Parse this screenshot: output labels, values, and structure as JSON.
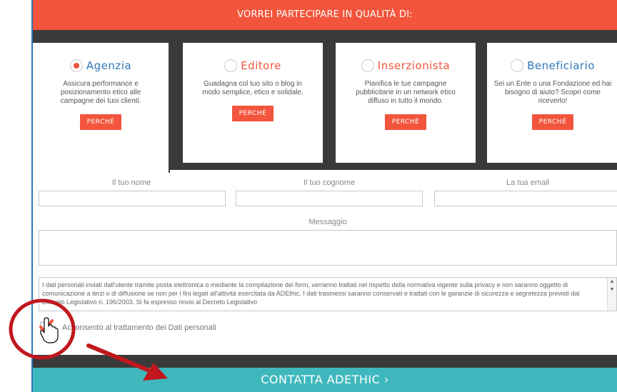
{
  "header": {
    "title": "VORREI PARTECIPARE IN QUALITÀ DI:"
  },
  "roles": [
    {
      "name": "Agenzia",
      "selected": true,
      "description": "Assicura performance e posizionamento etico alle campagne dei tuoi clienti.",
      "button": "PERCHÉ"
    },
    {
      "name": "Editore",
      "selected": false,
      "description": "Guadagna col tuo sito o blog in modo semplice, etico e solidale.",
      "button": "PERCHÉ"
    },
    {
      "name": "Inserzionista",
      "selected": false,
      "description": "Pianifica le tue campagne pubblicitarie in un network etico diffuso in tutto il mondo.",
      "button": "PERCHÉ"
    },
    {
      "name": "Beneficiario",
      "selected": false,
      "description": "Sei un Ente o una Fondazione ed hai bisogno di aiuto? Scopri come riceverlo!",
      "button": "PERCHÉ"
    }
  ],
  "form": {
    "name_label": "Il tuo nome",
    "surname_label": "Il tuo cognome",
    "email_label": "La tua email",
    "message_label": "Messaggio",
    "privacy_text": "I dati personali inviati dall'utente tramite posta elettronica o mediante la compilazione dei form, verranno trattati nel rispetto della normativa vigente sulla privacy e non saranno oggetto di comunicazione a terzi o di diffusione se non per i fini legati all'attività esercitata da ADEthic. I dati trasmessi saranno conservati e trattati con le garanzie di sicurezza e segretezza previsti dal Decreto Legislativo n. 196/2003. Si fa espresso rinvio al Decreto Legislativo",
    "consent_label": "Acconsento al trattamento dei Dati personali",
    "consent_checked": true
  },
  "cta": {
    "label": "CONTATTA ADETHIC ›"
  },
  "colors": {
    "accent": "#f2553c",
    "dark": "#3a3a3a",
    "teal": "#3fb8bd",
    "annotation": "#c0171d"
  }
}
